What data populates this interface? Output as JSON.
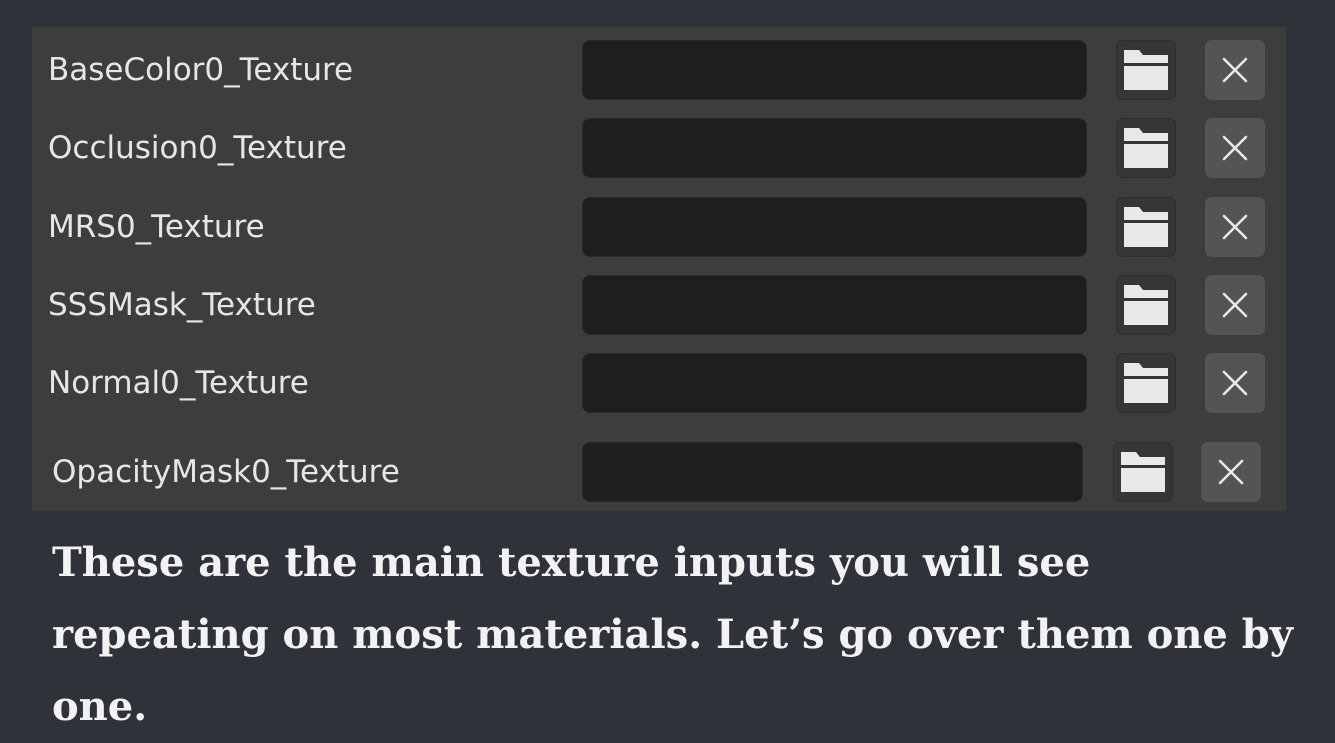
{
  "texture_panel": {
    "rows": [
      {
        "label": "BaseColor0_Texture",
        "value": ""
      },
      {
        "label": "Occlusion0_Texture",
        "value": ""
      },
      {
        "label": "MRS0_Texture",
        "value": ""
      },
      {
        "label": "SSSMask_Texture",
        "value": ""
      },
      {
        "label": "Normal0_Texture",
        "value": ""
      },
      {
        "label": "OpacityMask0_Texture",
        "value": ""
      }
    ],
    "browse_icon": "folder-icon",
    "clear_icon": "close-icon"
  },
  "caption": {
    "text": "These are the main texture inputs you will see repeating on most materials. Let’s go over them one by one."
  },
  "colors": {
    "background": "#30323a",
    "panel": "#3d3d3d",
    "field": "#1e1e1e",
    "clear_button": "#545454",
    "folder_icon": "#e8e8e8"
  }
}
